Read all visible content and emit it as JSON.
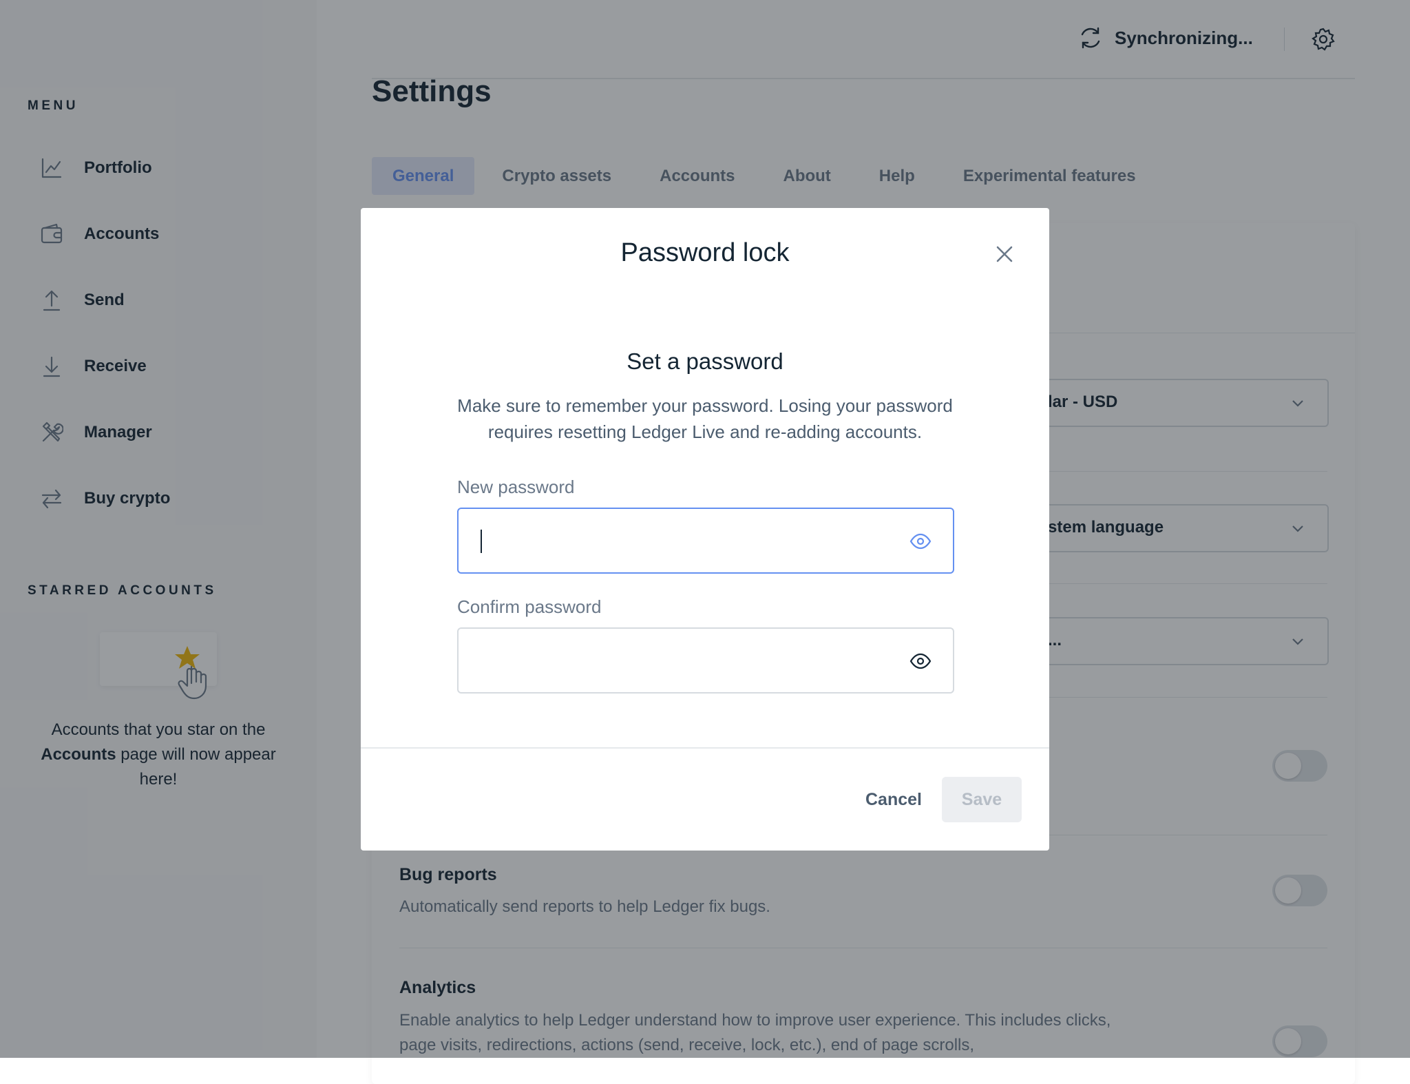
{
  "sidebar": {
    "menu_title": "MENU",
    "items": [
      {
        "label": "Portfolio",
        "icon": "chart-icon"
      },
      {
        "label": "Accounts",
        "icon": "wallet-icon"
      },
      {
        "label": "Send",
        "icon": "send-arrow-icon"
      },
      {
        "label": "Receive",
        "icon": "receive-arrow-icon"
      },
      {
        "label": "Manager",
        "icon": "tools-icon"
      },
      {
        "label": "Buy crypto",
        "icon": "exchange-icon"
      }
    ],
    "starred_title": "STARRED ACCOUNTS",
    "starred_text_pre": "Accounts that you star on the ",
    "starred_text_bold": "Accounts",
    "starred_text_post": " page will now appear here!"
  },
  "topbar": {
    "sync_label": "Synchronizing..."
  },
  "page": {
    "title": "Settings",
    "tabs": [
      "General",
      "Crypto assets",
      "Accounts",
      "About",
      "Help",
      "Experimental features"
    ],
    "active_tab": "General",
    "selects": [
      "lar - USD",
      "stem language",
      "..."
    ],
    "rows": [
      {
        "title": "Bug reports",
        "desc": "Automatically send reports to help Ledger fix bugs."
      },
      {
        "title": "Analytics",
        "desc": "Enable analytics to help Ledger understand how to improve user experience. This includes clicks, page visits, redirections, actions (send, receive, lock, etc.), end of page scrolls,"
      }
    ]
  },
  "modal": {
    "title": "Password lock",
    "subtitle": "Set a password",
    "description": "Make sure to remember your password. Losing your password requires resetting Ledger Live and re-adding accounts.",
    "new_password_label": "New password",
    "new_password_value": "",
    "confirm_password_label": "Confirm password",
    "confirm_password_value": "",
    "cancel_label": "Cancel",
    "save_label": "Save"
  },
  "colors": {
    "accent": "#6490f1",
    "text": "#142533",
    "muted": "#6a7889",
    "star": "#f0b90b"
  }
}
